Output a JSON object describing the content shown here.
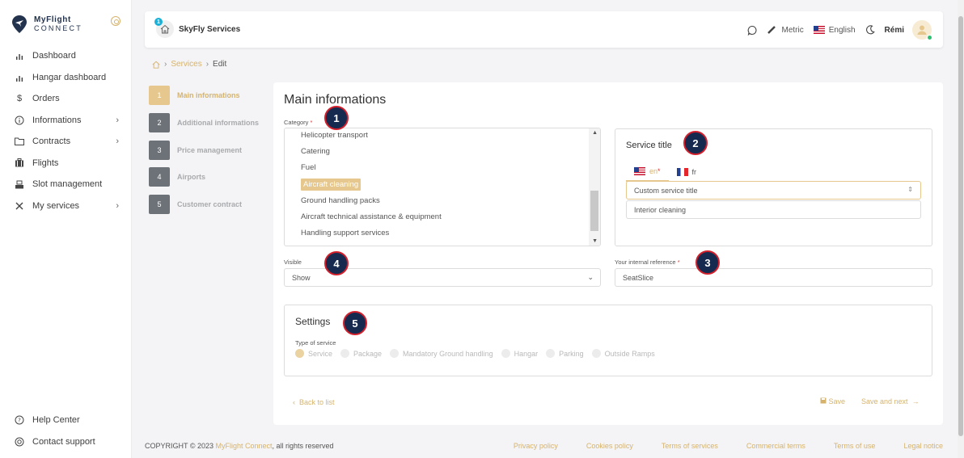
{
  "brand": {
    "line1": "MyFlight",
    "line2": "CONNECT"
  },
  "sidebar": {
    "items": [
      {
        "label": "Dashboard",
        "icon": "bar-chart-icon"
      },
      {
        "label": "Hangar dashboard",
        "icon": "bar-chart-icon"
      },
      {
        "label": "Orders",
        "icon": "dollar-icon"
      },
      {
        "label": "Informations",
        "icon": "info-icon"
      },
      {
        "label": "Contracts",
        "icon": "folder-icon"
      },
      {
        "label": "Flights",
        "icon": "suitcase-icon"
      },
      {
        "label": "Slot management",
        "icon": "inbox-icon"
      },
      {
        "label": "My services",
        "icon": "tools-icon"
      }
    ],
    "bottom": [
      {
        "label": "Help Center",
        "icon": "help-icon"
      },
      {
        "label": "Contact support",
        "icon": "support-icon"
      }
    ]
  },
  "topbar": {
    "badge": "1",
    "company": "SkyFly Services",
    "units": "Metric",
    "language": "English",
    "user": "Rémi"
  },
  "breadcrumb": {
    "services": "Services",
    "current": "Edit"
  },
  "steps": [
    {
      "num": "1",
      "label": "Main informations"
    },
    {
      "num": "2",
      "label": "Additional informations"
    },
    {
      "num": "3",
      "label": "Price management"
    },
    {
      "num": "4",
      "label": "Airports"
    },
    {
      "num": "5",
      "label": "Customer contract"
    }
  ],
  "form": {
    "title": "Main informations",
    "category_label": "Category",
    "categories": [
      "Helicopter transport",
      "Catering",
      "Fuel",
      "Aircraft cleaning",
      "Ground handling packs",
      "Aircraft technical assistance & equipment",
      "Handling support services"
    ],
    "selected_category": "Aircraft cleaning",
    "service_title_label": "Service title",
    "lang_en": "en",
    "lang_fr": "fr",
    "title_select": "Custom service title",
    "title_value": "Interior cleaning",
    "visible_label": "Visible",
    "visible_value": "Show",
    "reference_label": "Your internal reference",
    "reference_value": "SeatSlice",
    "settings_title": "Settings",
    "type_label": "Type of service",
    "types": [
      "Service",
      "Package",
      "Mandatory Ground handling",
      "Hangar",
      "Parking",
      "Outside Ramps"
    ],
    "back": "Back to list",
    "save": "Save",
    "save_next": "Save and next"
  },
  "markers": [
    "1",
    "2",
    "3",
    "4",
    "5"
  ],
  "footer": {
    "copy_prefix": "COPYRIGHT © 2023 ",
    "brand": "MyFlight Connect",
    "copy_suffix": ", all rights reserved",
    "links": [
      "Privacy policy",
      "Cookies policy",
      "Terms of services",
      "Commercial terms",
      "Terms of use",
      "Legal notice"
    ]
  },
  "colors": {
    "accent": "#d6b36d",
    "accent_light": "#e6c88e",
    "marker_bg": "#162a4f",
    "marker_border": "#d21f2b"
  }
}
